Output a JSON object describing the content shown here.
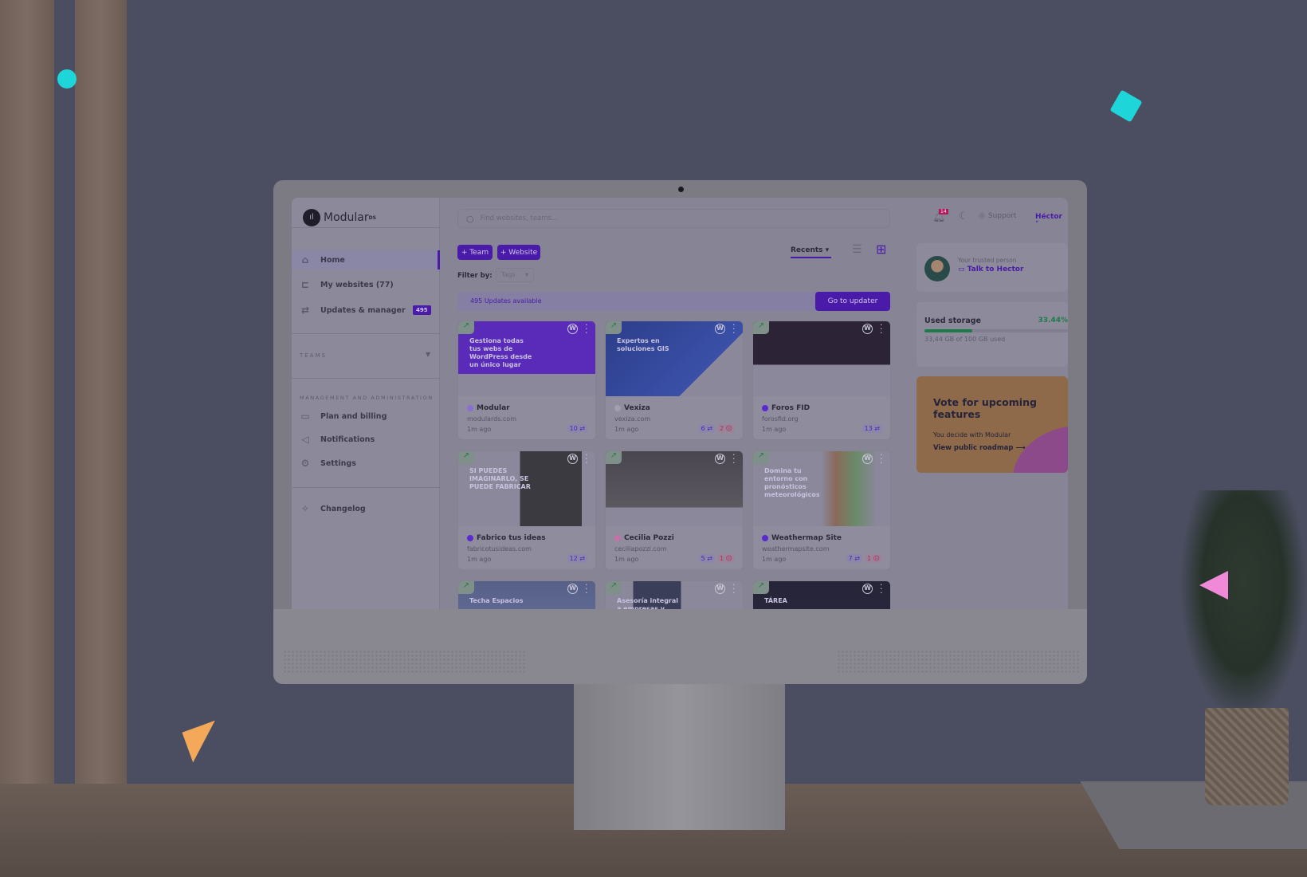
{
  "app": {
    "logo": "Modular",
    "logo_sup": "DS"
  },
  "header": {
    "search_placeholder": "Find websites, teams...",
    "notifications_count": "14",
    "support": "Support",
    "user": "Héctor"
  },
  "sidebar": {
    "items": [
      {
        "label": "Home",
        "icon": "home-icon",
        "active": true
      },
      {
        "label": "My websites (77)",
        "icon": "sitemap-icon"
      },
      {
        "label": "Updates & manager",
        "icon": "arrows-icon",
        "badge": "495"
      }
    ],
    "teams_label": "TEAMS",
    "management_label": "MANAGEMENT AND ADMINISTRATION",
    "management_items": [
      {
        "label": "Plan and billing",
        "icon": "credit-card-icon"
      },
      {
        "label": "Notifications",
        "icon": "megaphone-icon"
      },
      {
        "label": "Settings",
        "icon": "gear-icon"
      }
    ],
    "changelog": "Changelog"
  },
  "toolbar": {
    "add_team": "+ Team",
    "add_website": "+ Website",
    "sort": "Recents",
    "filter_label": "Filter by:",
    "filter_value": "Tags"
  },
  "updates_banner": {
    "text": "495 Updates available",
    "button": "Go to updater"
  },
  "cards": [
    {
      "name": "Modular",
      "domain": "modulards.com",
      "ago": "1m ago",
      "updates": "10 ⇄",
      "errors": "",
      "thumb_text": "Gestiona todas tus webs de WordPress desde un único lugar",
      "dot": "#8a6fd0"
    },
    {
      "name": "Vexiza",
      "domain": "vexiza.com",
      "ago": "1m ago",
      "updates": "6 ⇄",
      "errors": "2 ☹",
      "thumb_text": "Expertos en soluciones GIS",
      "dot": "#a09fae"
    },
    {
      "name": "Foros FID",
      "domain": "forosfid.org",
      "ago": "1m ago",
      "updates": "13 ⇄",
      "errors": "",
      "thumb_text": "",
      "dot": "#5a2ad0"
    },
    {
      "name": "Fabrico tus ideas",
      "domain": "fabricotusideas.com",
      "ago": "1m ago",
      "updates": "12 ⇄",
      "errors": "",
      "thumb_text": "SI PUEDES IMAGINARLO, SE PUEDE FABRICAR",
      "dot": "#5a2ad0"
    },
    {
      "name": "Cecilia Pozzi",
      "domain": "ceciliapozzi.com",
      "ago": "1m ago",
      "updates": "5 ⇄",
      "errors": "1 ☹",
      "thumb_text": "",
      "dot": "#c770a8"
    },
    {
      "name": "Weathermap Site",
      "domain": "weathermapsite.com",
      "ago": "1m ago",
      "updates": "7 ⇄",
      "errors": "1 ☹",
      "thumb_text": "Domina tu entorno con pronósticos meteorológicos",
      "dot": "#5a2ad0"
    },
    {
      "name": "",
      "domain": "",
      "ago": "",
      "updates": "",
      "errors": "",
      "thumb_text": "Techa Espacios",
      "dot": ""
    },
    {
      "name": "",
      "domain": "",
      "ago": "",
      "updates": "",
      "errors": "",
      "thumb_text": "Asesoría integral a empresas y asociaciones",
      "dot": ""
    },
    {
      "name": "",
      "domain": "",
      "ago": "",
      "updates": "",
      "errors": "",
      "thumb_text": "TÁREA",
      "dot": ""
    }
  ],
  "trusted": {
    "label": "Your trusted person",
    "link": "Talk to Hector"
  },
  "storage": {
    "title": "Used storage",
    "percent": "33.44%",
    "percent_value": 33.44,
    "detail": "33,44 GB of 100 GB used"
  },
  "vote": {
    "title": "Vote for upcoming features",
    "subtitle": "You decide with Modular",
    "link": "View public roadmap"
  },
  "colors": {
    "accent": "#4a1aa8",
    "storage_bar": "#1f7a4a",
    "vote_bg": "#8f6a4a",
    "vote_blob": "#8d4a8a"
  }
}
